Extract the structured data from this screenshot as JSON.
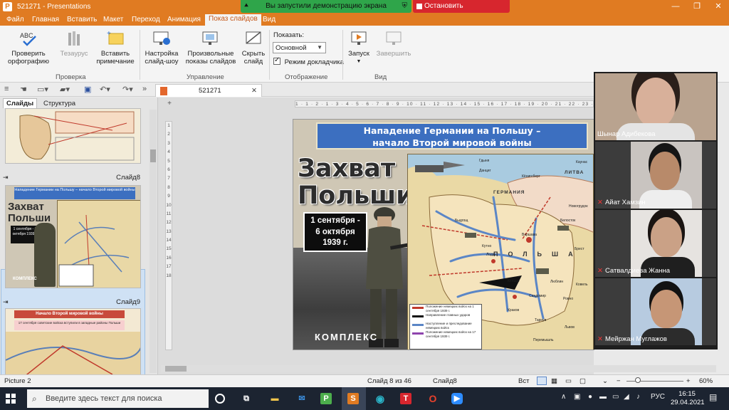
{
  "window": {
    "title": "521271 - Presentations",
    "controls": [
      "—",
      "❐",
      "✕"
    ]
  },
  "share": {
    "banner_text": "Вы запустили демонстрацию экрана",
    "stop_label": "Остановить демонстрацию"
  },
  "menu": {
    "tabs": [
      "Файл",
      "Главная",
      "Вставить",
      "Макет",
      "Переход",
      "Анимация",
      "Показ слайдов",
      "Вид"
    ],
    "active": "Показ слайдов"
  },
  "ribbon": {
    "spelling": "Проверить орфографию",
    "thesaurus": "Тезаурус",
    "insert_comment": "Вставить примечание",
    "group_review": "Проверка",
    "setup_show": "Настройка слайд-шоу",
    "custom_show": "Произвольные показы слайдов",
    "hide_slide": "Скрыть слайд",
    "group_manage": "Управление",
    "show_label": "Показать:",
    "show_value": "Основной",
    "presenter_mode": "Режим докладчика",
    "group_display": "Отображение",
    "start": "Запуск",
    "finish": "Завершить",
    "group_view": "Вид"
  },
  "document_tab": {
    "name": "521271",
    "close": "✕"
  },
  "slides_panel": {
    "tab_slides": "Слайды",
    "tab_outline": "Структура",
    "slide8_label": "Слайд8",
    "slide9_label": "Слайд9",
    "thumb8_title": "Нападение Германии на Польшу – начало Второй мировой войны",
    "thumb8_big": "Захват Польши",
    "thumb8_date": "1 сентября - 6 октября 1939 г.",
    "thumb8_logo": "КОМПЛЕКС",
    "thumb9_title": "Начало Второй мировой войны",
    "thumb9_text": "17 сентября советские войска вступили в западные районы Польши"
  },
  "slide": {
    "banner_line1": "Нападение Германии на Польшу –",
    "banner_line2": "начало Второй мировой войны",
    "big_line1": "Захват",
    "big_line2": "Польши",
    "date_line1": "1 сентября -",
    "date_line2": "6 октября",
    "date_line3": "1939 г.",
    "logo": "КОМПЛЕКС",
    "map": {
      "countries": [
        "ГЕРМАНИЯ",
        "ЛИТВА",
        "ПОЛЬША"
      ],
      "cities": [
        "Данциг",
        "Кёнигсберг",
        "Каунас",
        "Гдыня",
        "Варшава",
        "Лодзь",
        "Кельце",
        "Краков",
        "Брест",
        "Люблин",
        "Львов",
        "Ковель",
        "Сандомир",
        "Ровно",
        "Быдгощ",
        "Кутно",
        "Тарнув",
        "Перемышль",
        "Новогрудок",
        "Белосток"
      ],
      "legend": [
        "Положение немецких войск на 1 сентября 1939 г.",
        "Направление главных ударов",
        "Наступление и преследование немецких войск",
        "Положение немецких войск на 17 сентября 1939 г."
      ]
    }
  },
  "ruler": {
    "h_marks": "1 · 1 · 2 · 1 · 3 · 4 · 5 · 6 · 7 · 8 · 9 · 10 · 11 · 12 · 13 · 14 · 15 · 16 · 17 · 18 · 19 · 20 · 21 · 22 · 23 · 24 · 25",
    "v_marks": [
      "1",
      "2",
      "3",
      "4",
      "5",
      "6",
      "7",
      "8",
      "9",
      "10",
      "11",
      "12",
      "13",
      "14",
      "15",
      "16",
      "17",
      "18"
    ]
  },
  "video": {
    "participants": [
      {
        "name": "Шынар Адибекова",
        "muted": false
      },
      {
        "name": "Айат Хамзин",
        "muted": true
      },
      {
        "name": "Сатвалдиева Жанна",
        "muted": true
      },
      {
        "name": "Мейржан Муглажов",
        "muted": true
      }
    ]
  },
  "status": {
    "left": "Picture 2",
    "slide_of": "Слайд 8 из 46",
    "slide_name": "Слайд8",
    "lang": "Вст",
    "zoom": "60%"
  },
  "taskbar": {
    "search_placeholder": "Введите здесь текст для поиска",
    "lang": "РУС",
    "time": "16:15",
    "date": "29.04.2021"
  }
}
